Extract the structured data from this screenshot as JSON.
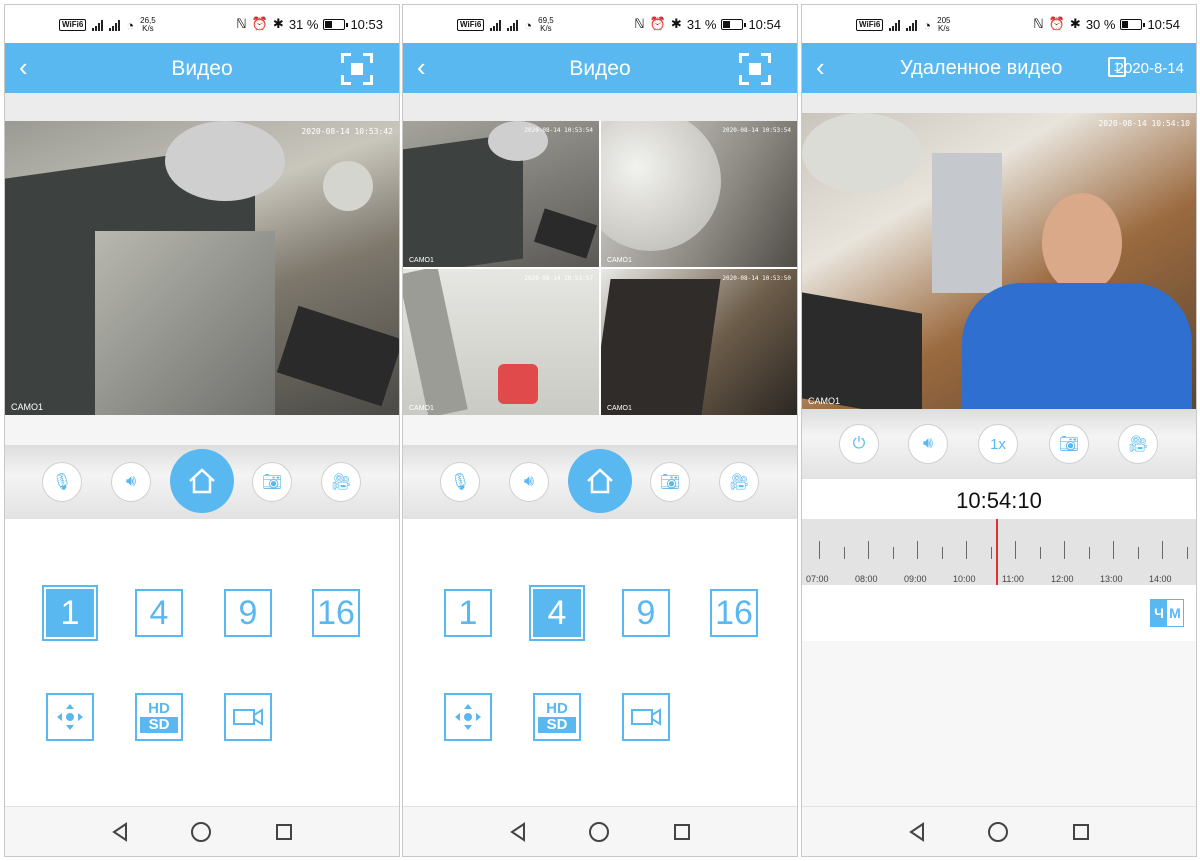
{
  "screens": [
    {
      "status": {
        "wifi_badge": "WiFi6",
        "speed": "26,5",
        "speed_unit": "K/s",
        "battery": "31 %",
        "time": "10:53"
      },
      "appbar": {
        "title": "Видео"
      },
      "video": {
        "timestamp": "2020-08-14 10:53:42",
        "camera_label": "CAMO1"
      },
      "grid_options": [
        "1",
        "4",
        "9",
        "16"
      ],
      "selected_grid": "1",
      "tools": {
        "hd": "HD",
        "sd": "SD"
      }
    },
    {
      "status": {
        "wifi_badge": "WiFi6",
        "speed": "69,5",
        "speed_unit": "K/s",
        "battery": "31 %",
        "time": "10:54"
      },
      "appbar": {
        "title": "Видео"
      },
      "cameras": [
        {
          "timestamp": "2020-08-14 10:53:54",
          "label": "CAMO1"
        },
        {
          "timestamp": "2020-08-14 10:53:54",
          "label": "CAMO1"
        },
        {
          "timestamp": "2020-08-14 10:53:57",
          "label": "CAMO1"
        },
        {
          "timestamp": "2020-08-14 10:53:50",
          "label": "CAMO1"
        }
      ],
      "grid_options": [
        "1",
        "4",
        "9",
        "16"
      ],
      "selected_grid": "4",
      "tools": {
        "hd": "HD",
        "sd": "SD"
      }
    },
    {
      "status": {
        "wifi_badge": "WiFi6",
        "speed": "205",
        "speed_unit": "K/s",
        "battery": "30 %",
        "time": "10:54"
      },
      "appbar": {
        "title": "Удаленное видео",
        "date": "2020-8-14",
        "date_icon": "1"
      },
      "video": {
        "timestamp": "2020-08-14 10:54:10",
        "camera_label": "CAMO1"
      },
      "speed_button": "1x",
      "current_time": "10:54:10",
      "timeline_labels": [
        "07:00",
        "08:00",
        "09:00",
        "10:00",
        "11:00",
        "12:00",
        "13:00",
        "14:00"
      ],
      "toggle": {
        "left": "Ч",
        "right": "М"
      }
    }
  ],
  "colors": {
    "accent": "#5ab8f0",
    "playhead": "#e53030"
  },
  "icons": [
    "back-chevron-icon",
    "fullscreen-icon",
    "microphone-icon",
    "speaker-icon",
    "home-icon",
    "camera-icon",
    "video-record-icon",
    "ptz-arrows-icon",
    "video-camera-icon",
    "power-icon",
    "calendar-icon"
  ]
}
